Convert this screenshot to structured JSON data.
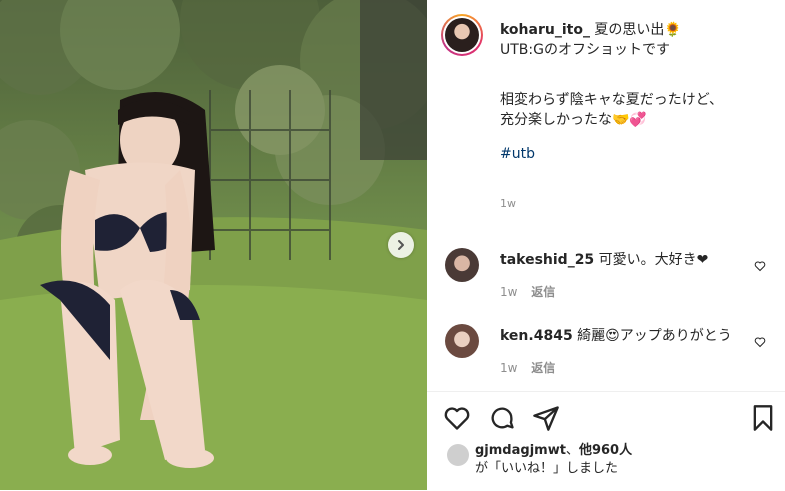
{
  "owner": {
    "username": "koharu_ito_",
    "caption_line1": "夏の思い出🌻",
    "caption_line2": "UTB:Gのオフショットです",
    "caption_line3": "相変わらず陰キャな夏だったけど、",
    "caption_line4": "充分楽しかったな🤝💞",
    "hashtag": "#utb",
    "time": "1w"
  },
  "comments": [
    {
      "username": "takeshid_25",
      "text": "可愛い。大好き❤",
      "time": "1w",
      "reply": "返信"
    },
    {
      "username": "ken.4845",
      "text": "綺麗😍アップありがとう",
      "time": "1w",
      "reply": "返信"
    }
  ],
  "likes": {
    "liker": "gjmdagjmwt",
    "separator": "、",
    "others": "他960人",
    "suffix": "が「いいね！」しました"
  },
  "icons": {
    "next": "chevron-right-icon",
    "like": "heart-icon",
    "comment": "comment-icon",
    "share": "paper-plane-icon",
    "save": "bookmark-icon"
  }
}
